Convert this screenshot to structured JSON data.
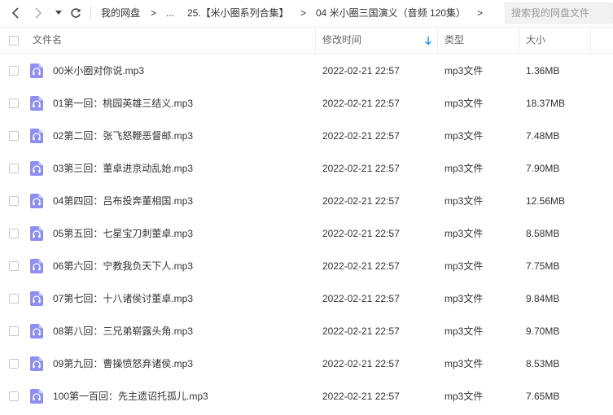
{
  "nav": {
    "back_icon": "chevron-left-icon",
    "forward_icon": "chevron-right-icon",
    "dropdown_icon": "caret-down-icon",
    "refresh_icon": "refresh-icon"
  },
  "breadcrumb": {
    "root": "我的网盘",
    "sep1": ">",
    "ellipsis": "...",
    "level1": "25.【米小圈系列合集】",
    "sep2": ">",
    "level2": "04 米小圈三国演义（音频 120集）",
    "sep3": ">"
  },
  "search": {
    "placeholder": "搜索我的网盘文件"
  },
  "columns": {
    "name": "文件名",
    "modified": "修改时间",
    "type": "类型",
    "size": "大小",
    "sort_icon": "arrow-down-icon"
  },
  "colors": {
    "accent": "#1e8cf0",
    "icon_purple": "#8f8ff2"
  },
  "files": [
    {
      "name": "00米小圈对你说.mp3",
      "modified": "2022-02-21 22:57",
      "type": "mp3文件",
      "size": "1.36MB"
    },
    {
      "name": "01第一回：桃园英雄三结义.mp3",
      "modified": "2022-02-21 22:57",
      "type": "mp3文件",
      "size": "18.37MB"
    },
    {
      "name": "02第二回：张飞怒鞭恶督邮.mp3",
      "modified": "2022-02-21 22:57",
      "type": "mp3文件",
      "size": "7.48MB"
    },
    {
      "name": "03第三回：董卓进京动乱始.mp3",
      "modified": "2022-02-21 22:57",
      "type": "mp3文件",
      "size": "7.90MB"
    },
    {
      "name": "04第四回：吕布投奔董相国.mp3",
      "modified": "2022-02-21 22:57",
      "type": "mp3文件",
      "size": "12.56MB"
    },
    {
      "name": "05第五回：七星宝刀刺董卓.mp3",
      "modified": "2022-02-21 22:57",
      "type": "mp3文件",
      "size": "8.58MB"
    },
    {
      "name": "06第六回：宁教我负天下人.mp3",
      "modified": "2022-02-21 22:57",
      "type": "mp3文件",
      "size": "7.75MB"
    },
    {
      "name": "07第七回：十八诸侯讨董卓.mp3",
      "modified": "2022-02-21 22:57",
      "type": "mp3文件",
      "size": "9.84MB"
    },
    {
      "name": "08第八回：三兄弟崭露头角.mp3",
      "modified": "2022-02-21 22:57",
      "type": "mp3文件",
      "size": "9.70MB"
    },
    {
      "name": "09第九回：曹操愤怒弃诸侯.mp3",
      "modified": "2022-02-21 22:57",
      "type": "mp3文件",
      "size": "8.53MB"
    },
    {
      "name": "100第一百回：先主遗诏托孤儿.mp3",
      "modified": "2022-02-21 22:57",
      "type": "mp3文件",
      "size": "7.65MB"
    }
  ]
}
